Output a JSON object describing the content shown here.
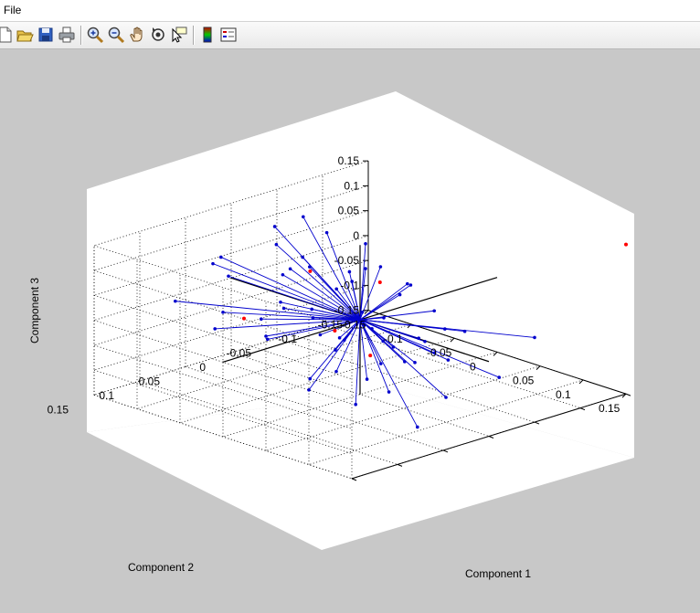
{
  "menu": {
    "items": [
      "File"
    ]
  },
  "toolbar": {
    "icons": [
      "new-file-icon",
      "open-folder-icon",
      "save-icon",
      "print-icon",
      "zoom-in-icon",
      "zoom-out-icon",
      "pan-hand-icon",
      "rotate-3d-icon",
      "data-cursor-icon",
      "colorbar-icon",
      "legend-icon"
    ]
  },
  "colors": {
    "background": "#c8c8c8",
    "axes": "#ffffff",
    "vector": "#0000cd",
    "observation": "#ff0000",
    "origin_axis": "#000000"
  },
  "chart_data": {
    "type": "scatter3d",
    "subtype": "biplot",
    "xlabel": "Component 1",
    "ylabel": "Component 2",
    "zlabel": "Component 3",
    "xlim": [
      -0.15,
      0.15
    ],
    "ylim": [
      -0.15,
      0.15
    ],
    "zlim": [
      -0.15,
      0.15
    ],
    "x_ticks": [
      "-0.15",
      "-0.1",
      "-0.05",
      "0",
      "0.05",
      "0.1",
      "0.15"
    ],
    "y_ticks": [
      "0.15",
      "0.1",
      "0.05",
      "0",
      "-0.05",
      "-0.1",
      "-0.15"
    ],
    "z_ticks": [
      "0.15",
      "0.1",
      "0.05",
      "0",
      "-0.05",
      "-0.1",
      "-0.15"
    ],
    "grid": true,
    "series": [
      {
        "kind": "vectors",
        "color": "#0000cd",
        "points": [
          [
            0.12,
            0.13,
            0.1
          ],
          [
            0.0,
            0.15,
            0.1
          ],
          [
            0.05,
            0.15,
            0.08
          ],
          [
            0.15,
            0.07,
            0.08
          ],
          [
            0.14,
            0.05,
            0.04
          ],
          [
            0.12,
            0.02,
            0.06
          ],
          [
            0.1,
            0.12,
            0.02
          ],
          [
            0.08,
            0.05,
            0.03
          ],
          [
            0.06,
            0.1,
            0.06
          ],
          [
            0.02,
            0.12,
            0.04
          ],
          [
            0.12,
            0.09,
            0.03
          ],
          [
            0.04,
            0.06,
            0.02
          ],
          [
            -0.02,
            0.14,
            0.05
          ],
          [
            0.14,
            0.1,
            -0.01
          ],
          [
            0.08,
            0.13,
            0.0
          ],
          [
            0.1,
            0.15,
            0.0
          ],
          [
            0.06,
            0.02,
            -0.01
          ],
          [
            -0.03,
            0.08,
            0.03
          ],
          [
            0.09,
            -0.03,
            0.01
          ],
          [
            0.15,
            -0.05,
            0.02
          ],
          [
            -0.13,
            -0.06,
            0.1
          ],
          [
            -0.11,
            -0.01,
            0.12
          ],
          [
            -0.06,
            -0.02,
            0.13
          ],
          [
            -0.13,
            0.03,
            0.07
          ],
          [
            -0.1,
            0.05,
            0.06
          ],
          [
            -0.06,
            0.02,
            0.08
          ],
          [
            -0.14,
            -0.04,
            0.05
          ],
          [
            -0.08,
            -0.02,
            0.05
          ],
          [
            -0.04,
            -0.06,
            0.05
          ],
          [
            -0.02,
            -0.01,
            0.06
          ],
          [
            -0.09,
            0.0,
            0.04
          ],
          [
            -0.12,
            -0.05,
            0.03
          ],
          [
            -0.15,
            0.02,
            0.04
          ],
          [
            -0.1,
            -0.1,
            0.04
          ],
          [
            -0.05,
            0.04,
            0.03
          ],
          [
            -0.13,
            0.08,
            0.01
          ],
          [
            -0.03,
            -0.08,
            0.01
          ],
          [
            -0.1,
            -0.1,
            -0.01
          ],
          [
            -0.07,
            -0.04,
            0.0
          ],
          [
            -0.14,
            -0.12,
            -0.05
          ],
          [
            -0.11,
            -0.02,
            -0.05
          ],
          [
            -0.06,
            -0.1,
            -0.04
          ],
          [
            -0.04,
            -0.04,
            -0.03
          ],
          [
            -0.09,
            -0.14,
            -0.06
          ],
          [
            -0.12,
            -0.06,
            -0.08
          ],
          [
            -0.05,
            -0.06,
            -0.08
          ],
          [
            -0.02,
            -0.1,
            -0.05
          ],
          [
            -0.08,
            -0.08,
            -0.1
          ],
          [
            -0.14,
            -0.08,
            -0.12
          ],
          [
            -0.1,
            -0.12,
            -0.12
          ],
          [
            -0.05,
            -0.02,
            -0.1
          ],
          [
            0.0,
            -0.06,
            -0.12
          ],
          [
            -0.07,
            -0.13,
            -0.15
          ],
          [
            0.02,
            -0.03,
            -0.09
          ],
          [
            0.06,
            -0.04,
            -0.07
          ],
          [
            0.1,
            0.0,
            -0.1
          ],
          [
            0.08,
            0.08,
            -0.08
          ],
          [
            0.13,
            -0.03,
            -0.06
          ],
          [
            0.04,
            0.03,
            -0.08
          ],
          [
            0.12,
            0.05,
            -0.12
          ]
        ]
      },
      {
        "kind": "observations",
        "color": "#ff0000",
        "points": [
          [
            0.15,
            -0.15,
            0.15
          ],
          [
            -0.05,
            0.08,
            0.02
          ],
          [
            -0.09,
            -0.03,
            0.03
          ],
          [
            -0.03,
            -0.05,
            0.03
          ],
          [
            -0.04,
            -0.01,
            -0.05
          ],
          [
            -0.02,
            -0.03,
            -0.1
          ]
        ]
      },
      {
        "kind": "axis-lines",
        "color": "#000000",
        "points": [
          [
            [
              0.15,
              0,
              0
            ],
            [
              -0.15,
              0,
              0
            ]
          ],
          [
            [
              0,
              0.15,
              0
            ],
            [
              0,
              -0.15,
              0
            ]
          ],
          [
            [
              0,
              0,
              0.15
            ],
            [
              0,
              0,
              -0.15
            ]
          ]
        ]
      }
    ]
  }
}
